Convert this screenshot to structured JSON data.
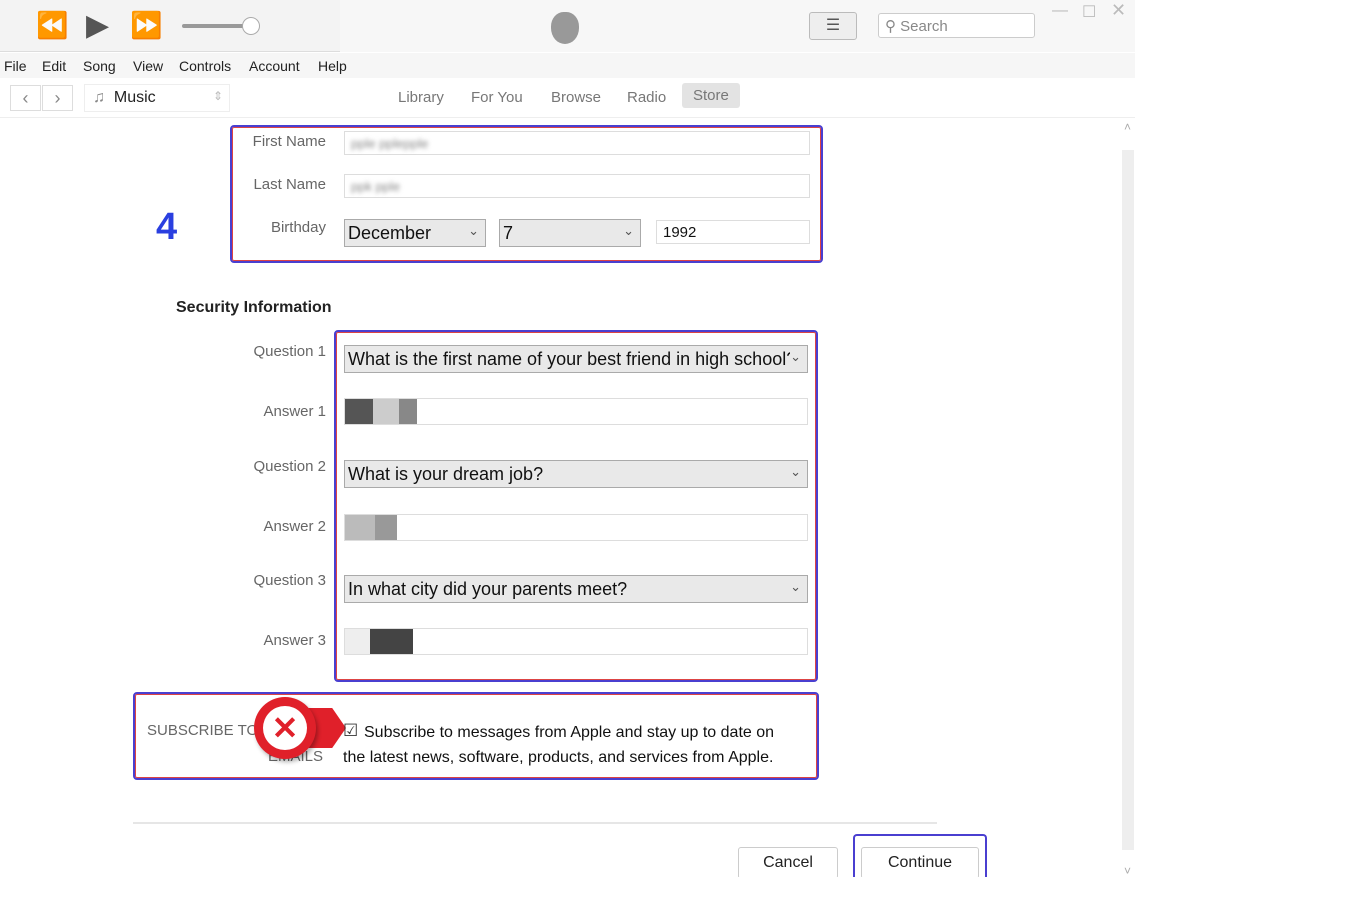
{
  "toolbar": {
    "search_placeholder": "Search",
    "icons": [
      "rewind-icon",
      "play-icon",
      "fast-forward-icon",
      "volume-slider",
      "apple-logo",
      "list-icon",
      "search-icon"
    ]
  },
  "menu": [
    "File",
    "Edit",
    "Song",
    "View",
    "Controls",
    "Account",
    "Help"
  ],
  "nav": {
    "source": "Music",
    "tabs": [
      "Library",
      "For You",
      "Browse",
      "Radio",
      "Store"
    ],
    "active_tab": "Store"
  },
  "step_number": "4",
  "personal": {
    "first_name_label": "First Name",
    "first_name_value": "pple pplepple",
    "last_name_label": "Last Name",
    "last_name_value": "ppk pple",
    "birthday_label": "Birthday",
    "month": "December",
    "day": "7",
    "year": "1992"
  },
  "security": {
    "heading": "Security Information",
    "items": [
      {
        "q_label": "Question 1",
        "question": "What is the first name of your best friend in high school?",
        "a_label": "Answer 1"
      },
      {
        "q_label": "Question 2",
        "question": "What is your dream job?",
        "a_label": "Answer 2"
      },
      {
        "q_label": "Question 3",
        "question": "In what city did your parents meet?",
        "a_label": "Answer 3"
      }
    ]
  },
  "subscribe": {
    "label_line1": "SUBSCRIBE TO",
    "label_line2": "EMAILS",
    "checked": true,
    "text_line1": "Subscribe to messages from Apple and stay up to date on",
    "text_line2": "the latest news, software, products, and services from Apple."
  },
  "buttons": {
    "cancel": "Cancel",
    "continue": "Continue"
  },
  "colors": {
    "highlight": "#4a3fd0",
    "step": "#2a3fe0",
    "error": "#e0202a"
  }
}
